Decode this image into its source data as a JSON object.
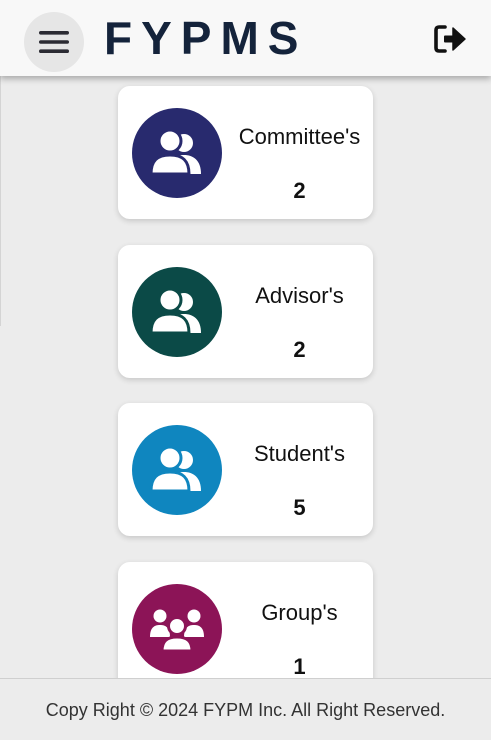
{
  "header": {
    "brand": "FYPMS",
    "menu_icon": "hamburger-menu-icon",
    "logout_icon": "sign-out-icon"
  },
  "cards": [
    {
      "title": "Committee's",
      "count": "2",
      "color": "#282a6e",
      "icon": "users-icon"
    },
    {
      "title": "Advisor's",
      "count": "2",
      "color": "#0b4a47",
      "icon": "users-icon"
    },
    {
      "title": "Student's",
      "count": "5",
      "color": "#0f86bf",
      "icon": "users-icon"
    },
    {
      "title": "Group's",
      "count": "1",
      "color": "#8c1457",
      "icon": "group-icon"
    }
  ],
  "footer": {
    "text": "Copy Right © 2024 FYPM Inc. All Right Reserved."
  }
}
